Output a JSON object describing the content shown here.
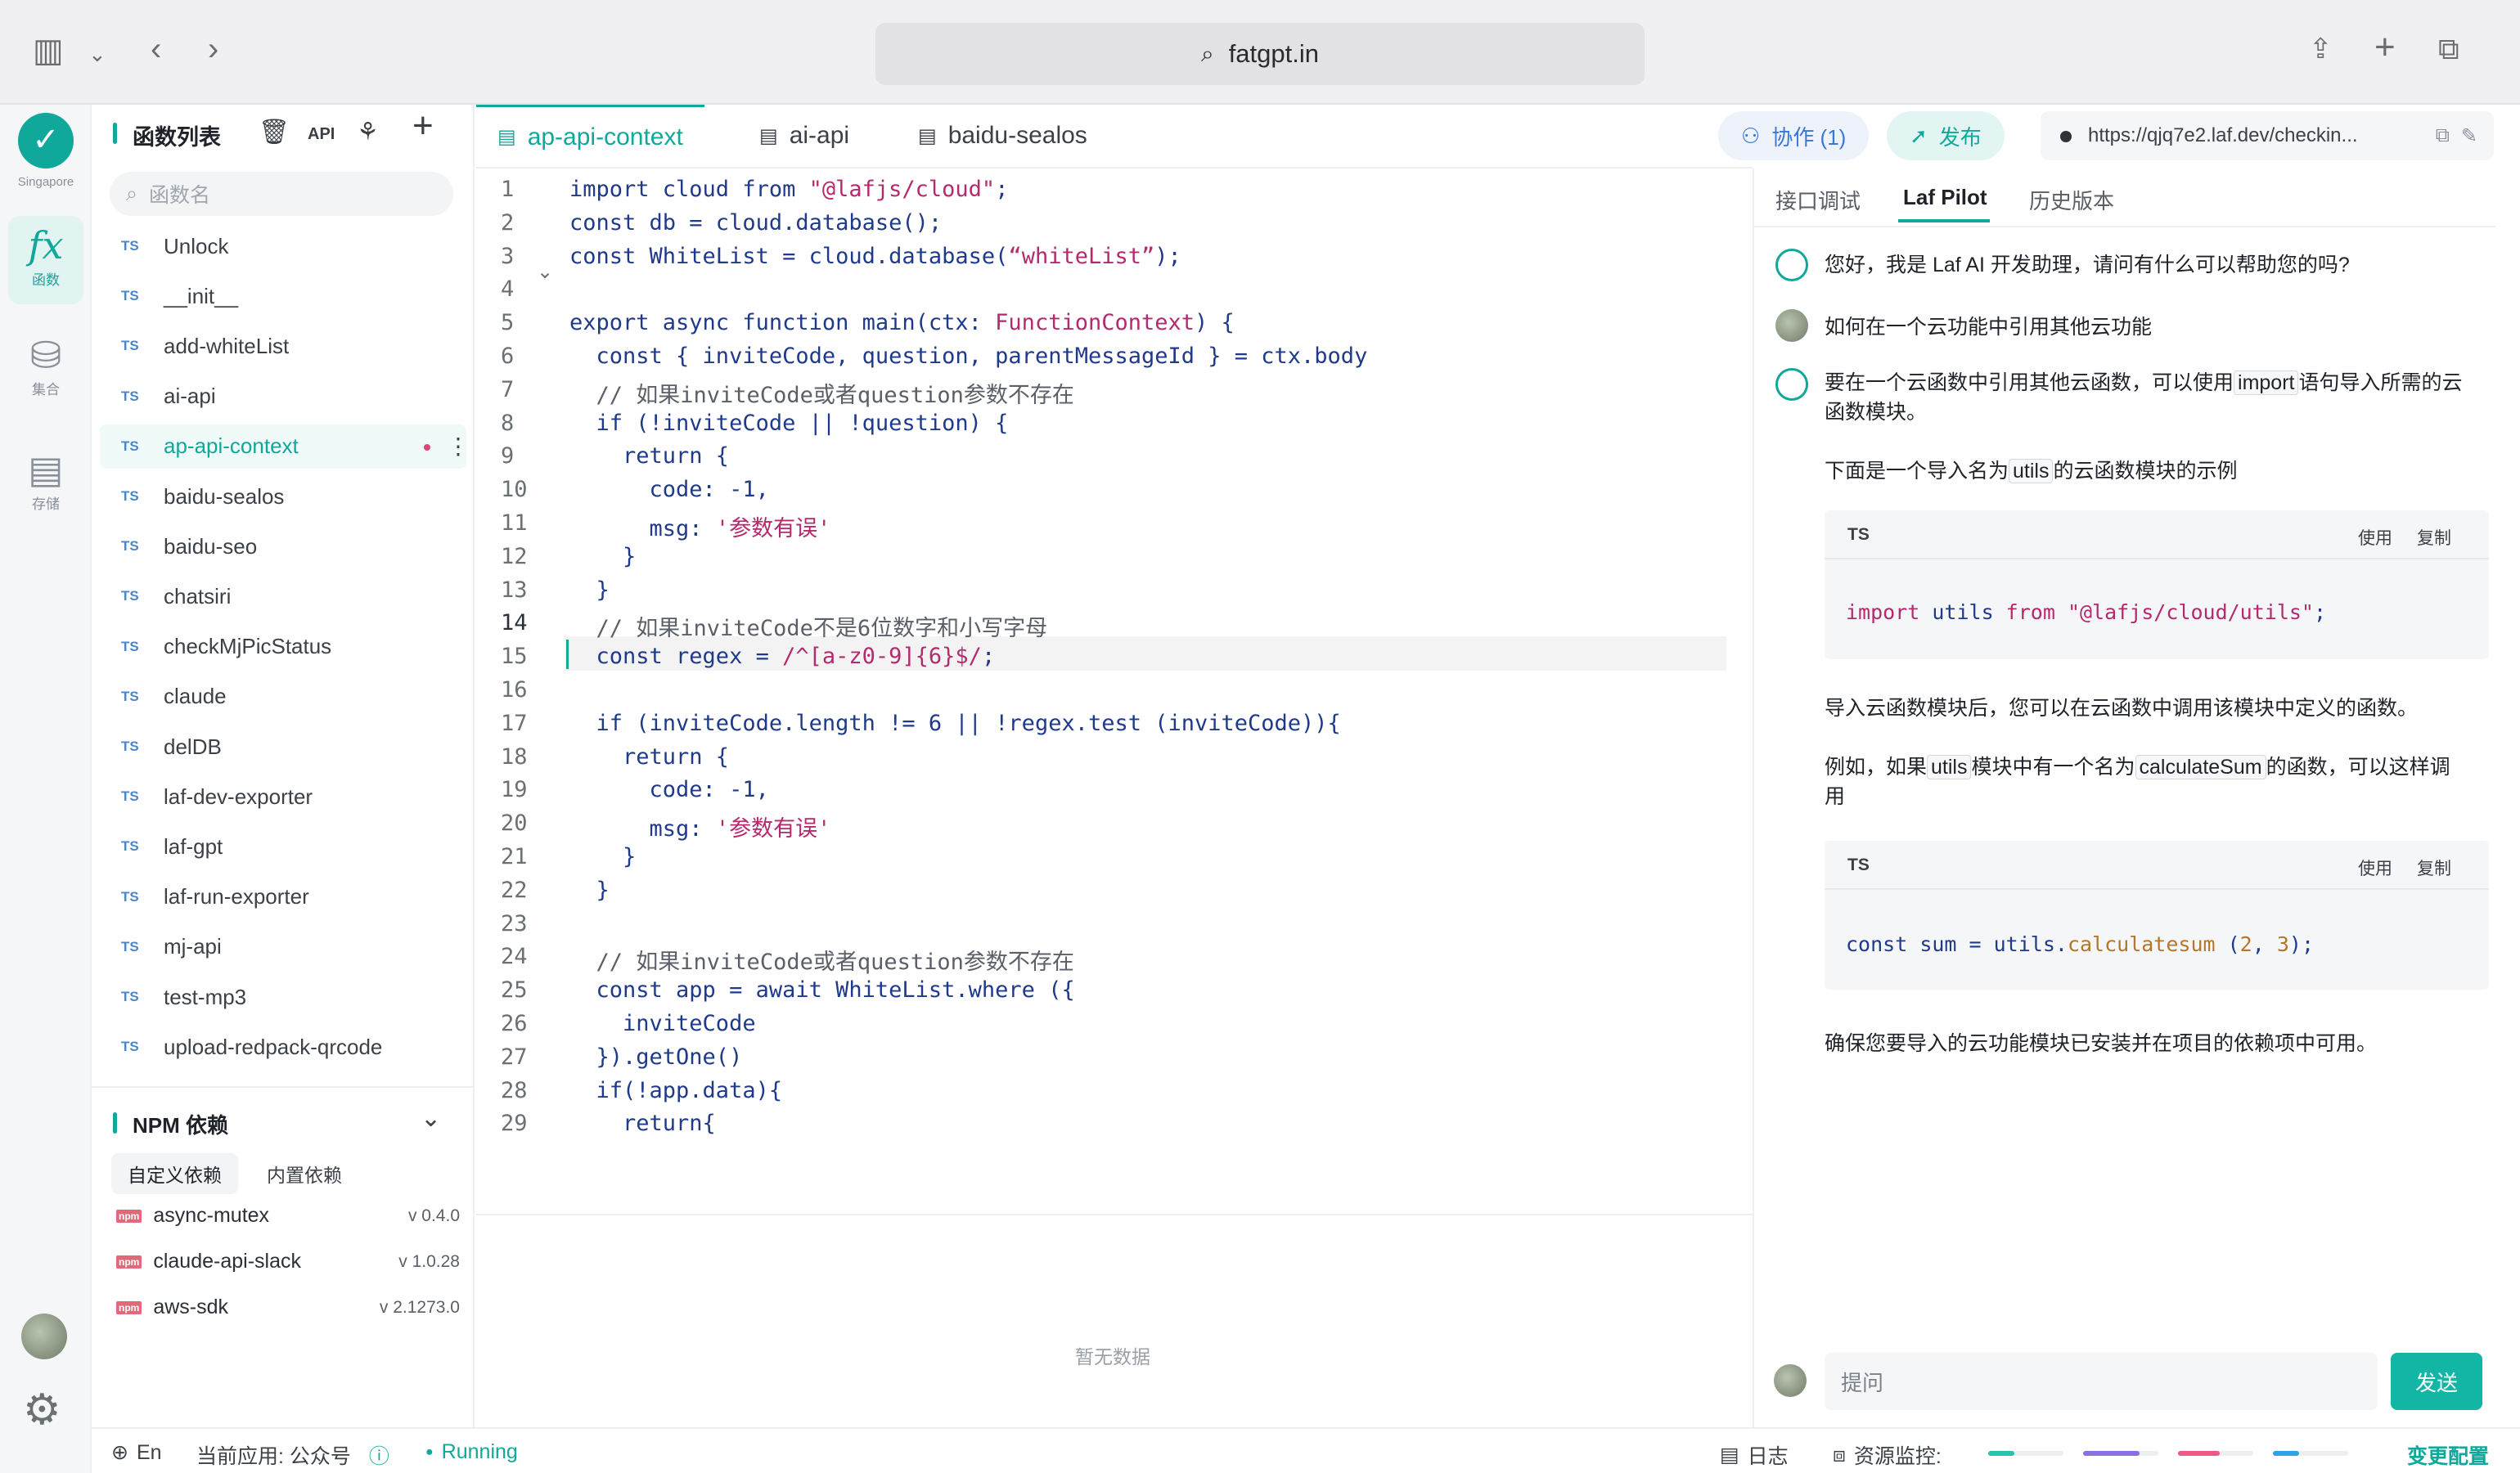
{
  "browser": {
    "url": "fatgpt.in",
    "icons": [
      "sidebar-toggle-icon",
      "chevron-down-icon",
      "back-icon",
      "forward-icon",
      "search-icon",
      "share-icon",
      "plus-icon",
      "tabs-icon"
    ]
  },
  "rail": {
    "region": "Singapore",
    "items": [
      {
        "label": "函数",
        "icon": "function-icon"
      },
      {
        "label": "集合",
        "icon": "database-icon"
      },
      {
        "label": "存储",
        "icon": "storage-icon"
      }
    ]
  },
  "fn_panel": {
    "title": "函数列表",
    "api_label": "API",
    "search_placeholder": "函数名",
    "lang_badge": "TS",
    "functions": [
      "Unlock",
      "__init__",
      "add-whiteList",
      "ai-api",
      "ap-api-context",
      "baidu-sealos",
      "baidu-seo",
      "chatsiri",
      "checkMjPicStatus",
      "claude",
      "delDB",
      "laf-dev-exporter",
      "laf-gpt",
      "laf-run-exporter",
      "mj-api",
      "test-mp3",
      "upload-redpack-qrcode"
    ],
    "active_function": "ap-api-context"
  },
  "npm": {
    "title": "NPM 依赖",
    "tabs": [
      "自定义依赖",
      "内置依赖"
    ],
    "icon_text": "npm",
    "packages": [
      {
        "name": "async-mutex",
        "version": "v 0.4.0"
      },
      {
        "name": "claude-api-slack",
        "version": "v 1.0.28"
      },
      {
        "name": "aws-sdk",
        "version": "v 2.1273.0"
      }
    ]
  },
  "editor": {
    "tabs": [
      "ap-api-context",
      "ai-api",
      "baidu-sealos"
    ],
    "current_line": 14,
    "lines": [
      "import cloud from \"@lafjs/cloud\";",
      "const db = cloud.database();",
      "const WhiteList = cloud.database(“whiteList”);",
      "",
      "export async function main(ctx: FunctionContext) {",
      "  const { inviteCode, question, parentMessageId } = ctx.body",
      "  // 如果inviteCode或者question参数不存在",
      "  if (!inviteCode || !question) {",
      "    return {",
      "      code: -1,",
      "      msg: '参数有误'",
      "    }",
      "  }",
      "  // 如果inviteCode不是6位数字和小写字母",
      "  const regex = /^[a-z0-9]{6}$/;",
      "",
      "  if (inviteCode.length != 6 || !regex.test (inviteCode)){",
      "    return {",
      "      code: -1,",
      "      msg: '参数有误'",
      "    }",
      "  }",
      "",
      "  // 如果inviteCode或者question参数不存在",
      "  const app = await WhiteList.where ({",
      "    inviteCode",
      "  }).getOne()",
      "  if(!app.data){",
      "    return{"
    ],
    "empty_text": "暂无数据"
  },
  "topbar": {
    "collab": "协作 (1)",
    "publish": "发布",
    "func_url": "https://qjq7e2.laf.dev/checkin..."
  },
  "chat": {
    "tabs": [
      "接口调试",
      "Laf Pilot",
      "历史版本"
    ],
    "active_tab": "Laf Pilot",
    "greeting": "您好，我是 Laf AI 开发助理，请问有什么可以帮助您的吗?",
    "user_question": "如何在一个云功能中引用其他云功能",
    "answer_intro_a": "要在一个云函数中引用其他云函数，可以使用",
    "answer_intro_code": "import",
    "answer_intro_b": "语句导入所需的云",
    "answer_intro_c": "函数模块。",
    "example_a": "下面是一个导入名为",
    "example_code": "utils",
    "example_b": "的云函数模块的示例",
    "code1_lang": "TS",
    "use_label": "使用",
    "copy_label": "复制",
    "code1": "import utils from \"@lafjs/cloud/utils\";",
    "after_import": "导入云函数模块后，您可以在云函数中调用该模块中定义的函数。",
    "example2_a": "例如，如果",
    "example2_code1": "utils",
    "example2_b": "模块中有一个名为",
    "example2_code2": "calculateSum",
    "example2_c": "的函数，可以这样调",
    "example2_d": "用",
    "code2_lang": "TS",
    "code2": "const sum = utils.calculatesum (2, 3);",
    "closing": "确保您要导入的云功能模块已安装并在项目的依赖项中可用。",
    "input_placeholder": "提问",
    "send_label": "发送"
  },
  "status": {
    "lang": "En",
    "current_app": "当前应用: 公众号",
    "state": "Running",
    "log": "日志",
    "monitor": "资源监控:",
    "change_config": "变更配置",
    "meters": [
      {
        "color": "#28c2b0",
        "level": 0.35
      },
      {
        "color": "#8b6fe0",
        "level": 0.75
      },
      {
        "color": "#ee5a83",
        "level": 0.55
      },
      {
        "color": "#2fa3e8",
        "level": 0.35
      }
    ]
  }
}
